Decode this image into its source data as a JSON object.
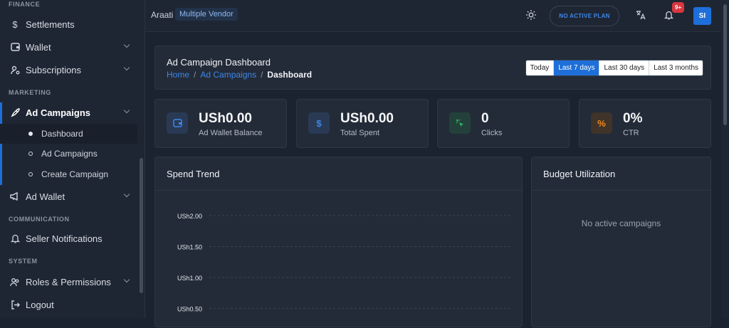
{
  "sidebar": {
    "sections": [
      "FINANCE",
      "MARKETING",
      "COMMUNICATION",
      "SYSTEM"
    ],
    "items": [
      {
        "label": "Settlements",
        "icon": "dollar-icon"
      },
      {
        "label": "Wallet",
        "icon": "wallet-icon"
      },
      {
        "label": "Subscriptions",
        "icon": "user-cog-icon"
      },
      {
        "label": "Ad Campaigns",
        "icon": "rocket-icon"
      },
      {
        "label": "Ad Wallet",
        "icon": "megaphone-icon"
      },
      {
        "label": "Seller Notifications",
        "icon": "bell-icon"
      },
      {
        "label": "Roles & Permissions",
        "icon": "users-icon"
      },
      {
        "label": "Logout",
        "icon": "logout-icon"
      }
    ],
    "sub_items": [
      "Dashboard",
      "Ad Campaigns",
      "Create Campaign"
    ]
  },
  "topbar": {
    "brand": "Araati",
    "vendor_badge": "Multiple Vendor",
    "plan_label": "NO ACTIVE PLAN",
    "notification_count": "9+",
    "avatar_initials": "SI"
  },
  "header": {
    "title": "Ad Campaign Dashboard",
    "breadcrumb": [
      "Home",
      "Ad Campaigns",
      "Dashboard"
    ],
    "breadcrumb_sep": "/",
    "ranges": [
      "Today",
      "Last 7 days",
      "Last 30 days",
      "Last 3 months"
    ],
    "active_range": "Last 7 days"
  },
  "stats": [
    {
      "value": "USh0.00",
      "label": "Ad Wallet Balance",
      "icon": "wallet-icon",
      "color": "#3d87e8"
    },
    {
      "value": "USh0.00",
      "label": "Total Spent",
      "icon": "dollar-icon",
      "color": "#3d87e8"
    },
    {
      "value": "0",
      "label": "Clicks",
      "icon": "cursor-click-icon",
      "color": "#2fb86a"
    },
    {
      "value": "0%",
      "label": "CTR",
      "icon": "percent-icon",
      "color": "#f08c1a"
    }
  ],
  "spend_trend": {
    "title": "Spend Trend",
    "y_ticks": [
      "USh2.00",
      "USh1.50",
      "USh1.00",
      "USh0.50"
    ]
  },
  "budget": {
    "title": "Budget Utilization",
    "empty_text": "No active campaigns"
  },
  "chart_data": {
    "type": "line",
    "title": "Spend Trend",
    "yticks": [
      "USh2.00",
      "USh1.50",
      "USh1.00",
      "USh0.50"
    ],
    "ylim": [
      0,
      2
    ],
    "grid": true,
    "series": []
  }
}
